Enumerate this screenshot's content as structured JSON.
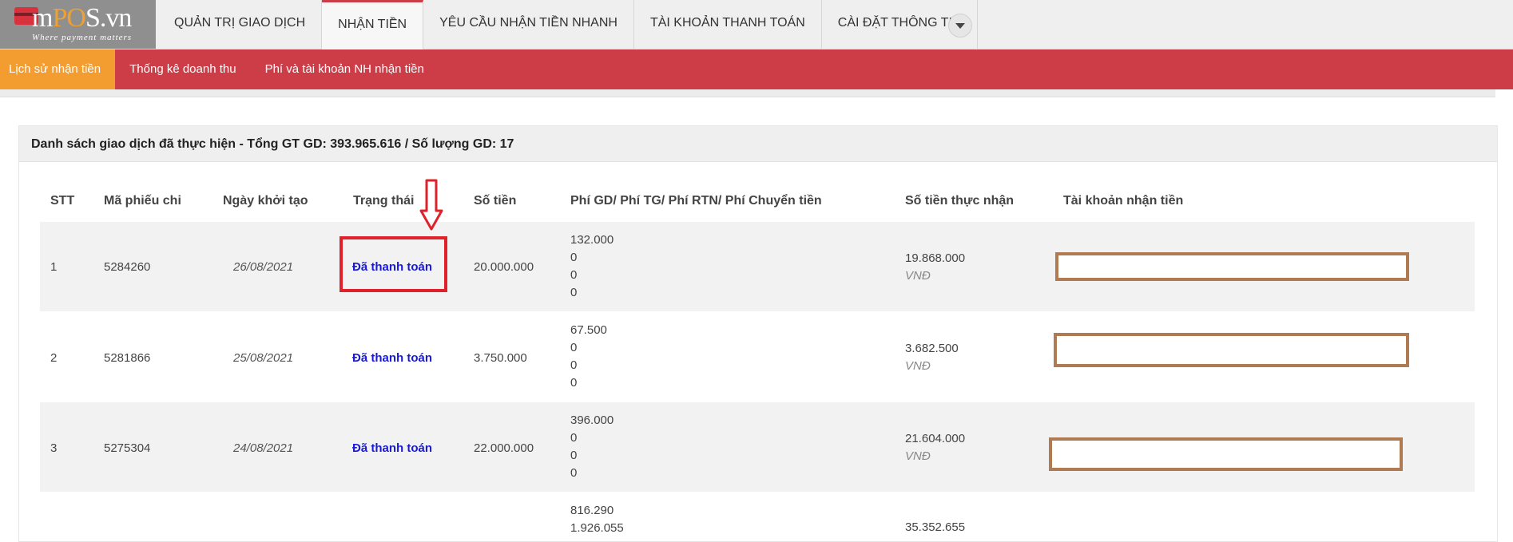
{
  "brand": {
    "name_m": "m",
    "name_p": "P",
    "name_rest": "S.vn",
    "name_o": "O",
    "tagline": "Where payment matters"
  },
  "nav": {
    "items": [
      {
        "label": "QUẢN TRỊ GIAO DỊCH"
      },
      {
        "label": "NHẬN TIỀN"
      },
      {
        "label": "YÊU CẦU NHẬN TIỀN NHANH"
      },
      {
        "label": "TÀI KHOẢN THANH TOÁN"
      },
      {
        "label": "CÀI ĐẶT THÔNG TIN"
      }
    ],
    "active_index": 1,
    "more_icon": "chevron-down-icon"
  },
  "subnav": {
    "items": [
      {
        "label": "Lịch sử nhận tiền"
      },
      {
        "label": "Thống kê doanh thu"
      },
      {
        "label": "Phí và tài khoản NH nhận tiền"
      }
    ]
  },
  "panel": {
    "title": "Danh sách giao dịch đã thực hiện - Tổng GT GD: 393.965.616 / Số lượng GD: 17"
  },
  "table": {
    "headers": [
      "STT",
      "Mã phiếu chi",
      "Ngày khởi tạo",
      "Trạng thái",
      "Số tiền",
      "Phí GD/ Phí TG/ Phí RTN/ Phí Chuyển tiền",
      "Số tiền thực nhận",
      "Tài khoản nhận tiền"
    ],
    "rows": [
      {
        "stt": "1",
        "code": "5284260",
        "date": "26/08/2021",
        "status": "Đã thanh toán",
        "amount": "20.000.000",
        "fees": [
          "132.000",
          "0",
          "0",
          "0"
        ],
        "net": "19.868.000",
        "currency": "VNĐ"
      },
      {
        "stt": "2",
        "code": "5281866",
        "date": "25/08/2021",
        "status": "Đã thanh toán",
        "amount": "3.750.000",
        "fees": [
          "67.500",
          "0",
          "0",
          "0"
        ],
        "net": "3.682.500",
        "currency": "VNĐ"
      },
      {
        "stt": "3",
        "code": "5275304",
        "date": "24/08/2021",
        "status": "Đã thanh toán",
        "amount": "22.000.000",
        "fees": [
          "396.000",
          "0",
          "0",
          "0"
        ],
        "net": "21.604.000",
        "currency": "VNĐ"
      },
      {
        "fees": [
          "816.290",
          "1.926.055"
        ],
        "net": "35.352.655"
      }
    ]
  },
  "colors": {
    "accent_red": "#cd3d47",
    "active_orange": "#f39c2f",
    "status_blue": "#1a1ad6",
    "highlight_red": "#e0202a",
    "redact_brown": "#b07a52"
  }
}
